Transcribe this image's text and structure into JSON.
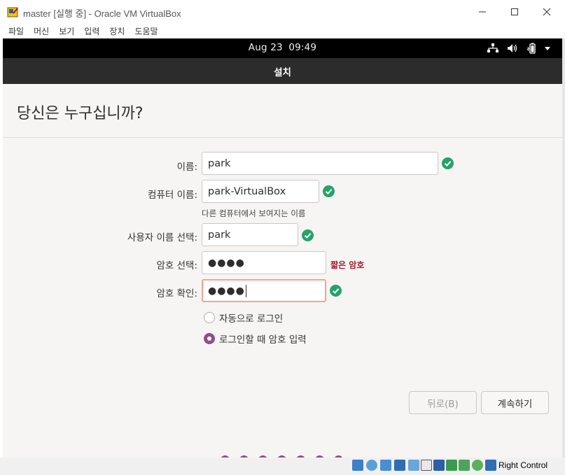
{
  "window": {
    "title": "master [실행 중] - Oracle VM VirtualBox",
    "menu": [
      "파일",
      "머신",
      "보기",
      "입력",
      "장치",
      "도움말"
    ]
  },
  "topbar": {
    "date": "Aug 23",
    "time": "09:49"
  },
  "installer": {
    "header_title": "설치",
    "page_title": "당신은 누구십니까?",
    "fields": {
      "name": {
        "label": "이름:",
        "value": "park"
      },
      "computer_name": {
        "label": "컴퓨터 이름:",
        "value": "park-VirtualBox",
        "hint": "다른 컴퓨터에서 보여지는 이름"
      },
      "username": {
        "label": "사용자 이름 선택:",
        "value": "park"
      },
      "password": {
        "label": "암호 선택:",
        "value": "●●●●",
        "warning": "짧은 암호"
      },
      "confirm_password": {
        "label": "암호 확인:",
        "value": "●●●●"
      }
    },
    "login_options": {
      "auto_login": "자동으로 로그인",
      "require_password": "로그인할 때 암호 입력"
    },
    "buttons": {
      "back": "뒤로(B)",
      "continue": "계속하기"
    },
    "progress_dots": 7
  },
  "statusbar": {
    "host_key": "Right Control"
  },
  "colors": {
    "accent": "#924d8b",
    "valid": "#26a269",
    "warning": "#a51d2d",
    "header_bg": "#2c2c2c"
  }
}
